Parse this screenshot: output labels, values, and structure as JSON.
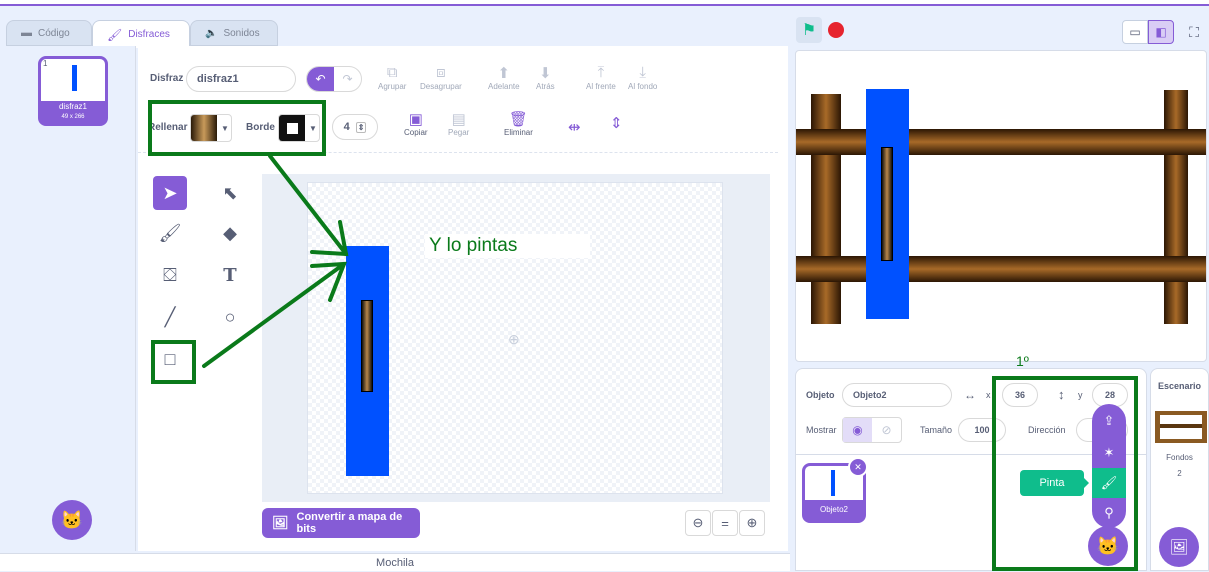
{
  "tabs": {
    "code": "Código",
    "costumes": "Disfraces",
    "sounds": "Sonidos"
  },
  "costume_list": {
    "number": "1",
    "name": "disfraz1",
    "size": "49 x 266"
  },
  "toolbar": {
    "costume_label": "Disfraz",
    "costume_value": "disfraz1",
    "group": "Agrupar",
    "ungroup": "Desagrupar",
    "forward": "Adelante",
    "backward": "Atrás",
    "front": "Al frente",
    "back": "Al fondo",
    "fill_label": "Rellenar",
    "outline_label": "Borde",
    "outline_size": "4",
    "copy": "Copiar",
    "paste": "Pegar",
    "delete": "Eliminar"
  },
  "canvas": {
    "annotation": "Y lo pintas"
  },
  "convert_button": "Convertir a mapa de bits",
  "backpack": "Mochila",
  "sprite_info": {
    "sprite_label": "Objeto",
    "sprite_name": "Objeto2",
    "x_label": "x",
    "x_value": "36",
    "y_label": "y",
    "y_value": "28",
    "show_label": "Mostrar",
    "size_label": "Tamaño",
    "size_value": "100",
    "direction_label": "Dirección"
  },
  "sprite_thumb": {
    "name": "Objeto2"
  },
  "stage_panel": {
    "title": "Escenario",
    "backdrops_label": "Fondos",
    "backdrops_count": "2"
  },
  "annotations": {
    "step": "1º",
    "paint_tooltip": "Pinta"
  },
  "colors": {
    "accent": "#855cd6",
    "highlight_box": "#0a7a1a",
    "paint_green": "#0fbd8c",
    "blue_rect": "#0051ff"
  }
}
